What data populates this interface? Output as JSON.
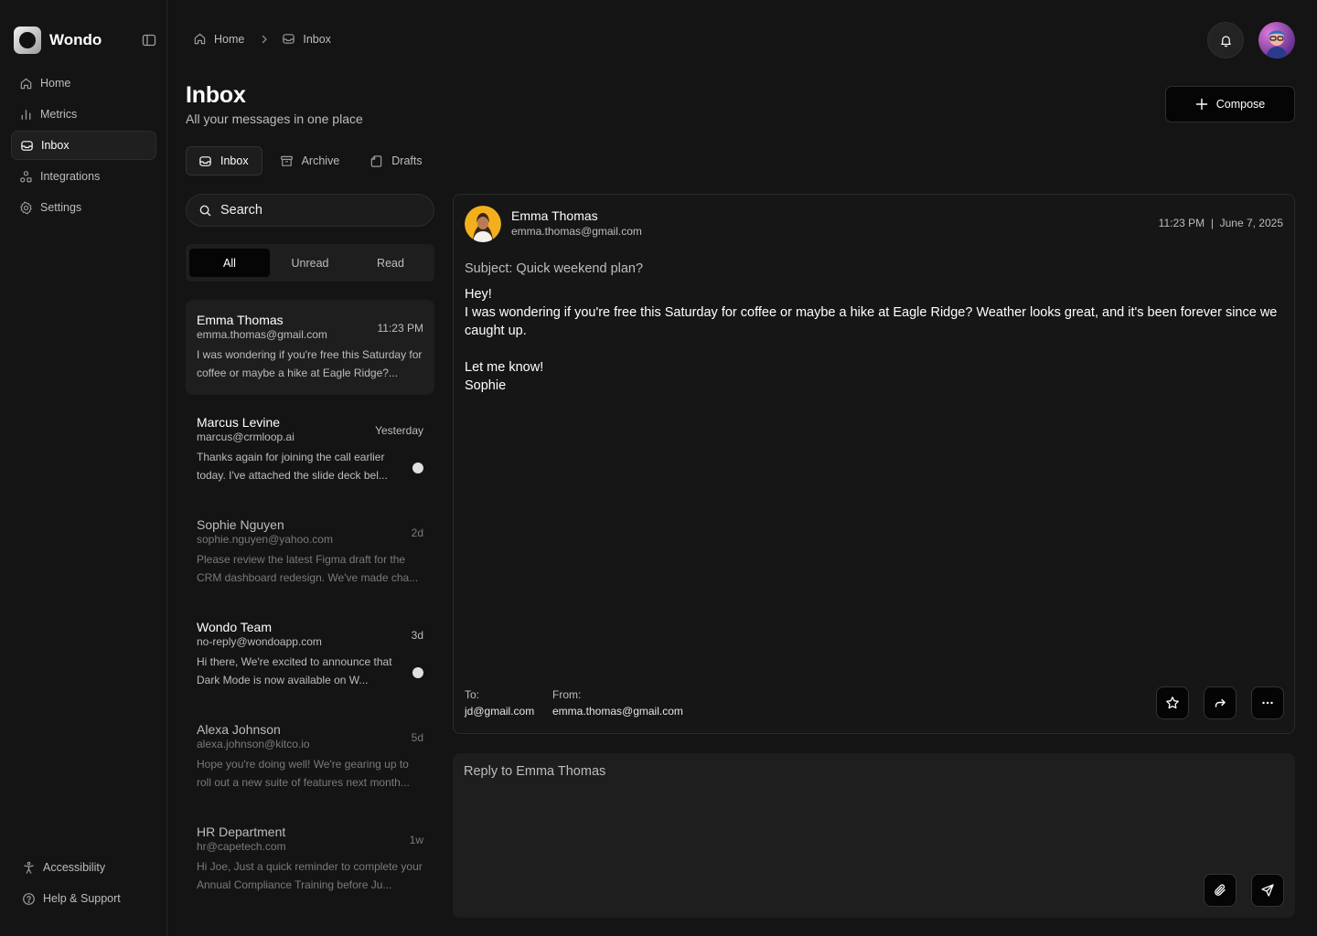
{
  "app": {
    "name": "Wondo"
  },
  "sidebar": {
    "items": [
      {
        "label": "Home",
        "icon": "home-icon"
      },
      {
        "label": "Metrics",
        "icon": "bar-chart-icon"
      },
      {
        "label": "Inbox",
        "icon": "inbox-icon",
        "active": true
      },
      {
        "label": "Integrations",
        "icon": "integrations-icon"
      },
      {
        "label": "Settings",
        "icon": "gear-icon"
      }
    ],
    "bottom": [
      {
        "label": "Accessibility",
        "icon": "accessibility-icon"
      },
      {
        "label": "Help & Support",
        "icon": "help-icon"
      }
    ]
  },
  "breadcrumb": {
    "home": "Home",
    "current": "Inbox"
  },
  "header": {
    "title": "Inbox",
    "subtitle": "All your messages in one place",
    "compose_label": "Compose"
  },
  "tabs": [
    {
      "label": "Inbox",
      "icon": "inbox-icon",
      "active": true
    },
    {
      "label": "Archive",
      "icon": "archive-icon"
    },
    {
      "label": "Drafts",
      "icon": "drafts-icon"
    }
  ],
  "search": {
    "placeholder": "Search"
  },
  "filters": [
    {
      "label": "All",
      "active": true
    },
    {
      "label": "Unread"
    },
    {
      "label": "Read"
    }
  ],
  "messages": [
    {
      "name": "Emma Thomas",
      "email": "emma.thomas@gmail.com",
      "time": "11:23 PM",
      "preview": "I was wondering if you're free this Saturday for coffee or maybe a hike at Eagle Ridge?...",
      "selected": true,
      "unread": false,
      "read": false
    },
    {
      "name": "Marcus Levine",
      "email": "marcus@crmloop.ai",
      "time": "Yesterday",
      "preview": "Thanks again for joining the call earlier today. I've attached the slide deck bel...",
      "unread": true
    },
    {
      "name": "Sophie Nguyen",
      "email": "sophie.nguyen@yahoo.com",
      "time": "2d",
      "preview": "Please review the latest Figma draft for the CRM dashboard redesign. We've made cha...",
      "read": true
    },
    {
      "name": "Wondo Team",
      "email": "no-reply@wondoapp.com",
      "time": "3d",
      "preview": "Hi there, We're excited to announce that Dark Mode is now available on W...",
      "unread": true
    },
    {
      "name": "Alexa Johnson",
      "email": "alexa.johnson@kitco.io",
      "time": "5d",
      "preview": "Hope you're doing well! We're gearing up to roll out a new suite of features next month...",
      "read": true
    },
    {
      "name": "HR Department",
      "email": "hr@capetech.com",
      "time": "1w",
      "preview": "Hi Joe, Just a quick reminder to complete your Annual Compliance Training before Ju...",
      "read": true
    }
  ],
  "detail": {
    "sender_name": "Emma Thomas",
    "sender_email": "emma.thomas@gmail.com",
    "datetime": "11:23 PM  |  June 7, 2025",
    "subject": "Subject: Quick weekend plan?",
    "body_greeting": "Hey!",
    "body_main": "I was wondering if you're free this Saturday for coffee or maybe a hike at Eagle Ridge? Weather looks great, and it's been forever since we caught up.",
    "body_closing": "Let me know!",
    "body_signature": "Sophie",
    "to_label": "To:",
    "to_value": "jd@gmail.com",
    "from_label": "From:",
    "from_value": "emma.thomas@gmail.com"
  },
  "reply": {
    "placeholder": "Reply to Emma Thomas"
  },
  "colors": {
    "background": "#141414",
    "panel": "#1e1e1e",
    "accent": "#ffffff",
    "muted": "#bdbdbd"
  }
}
